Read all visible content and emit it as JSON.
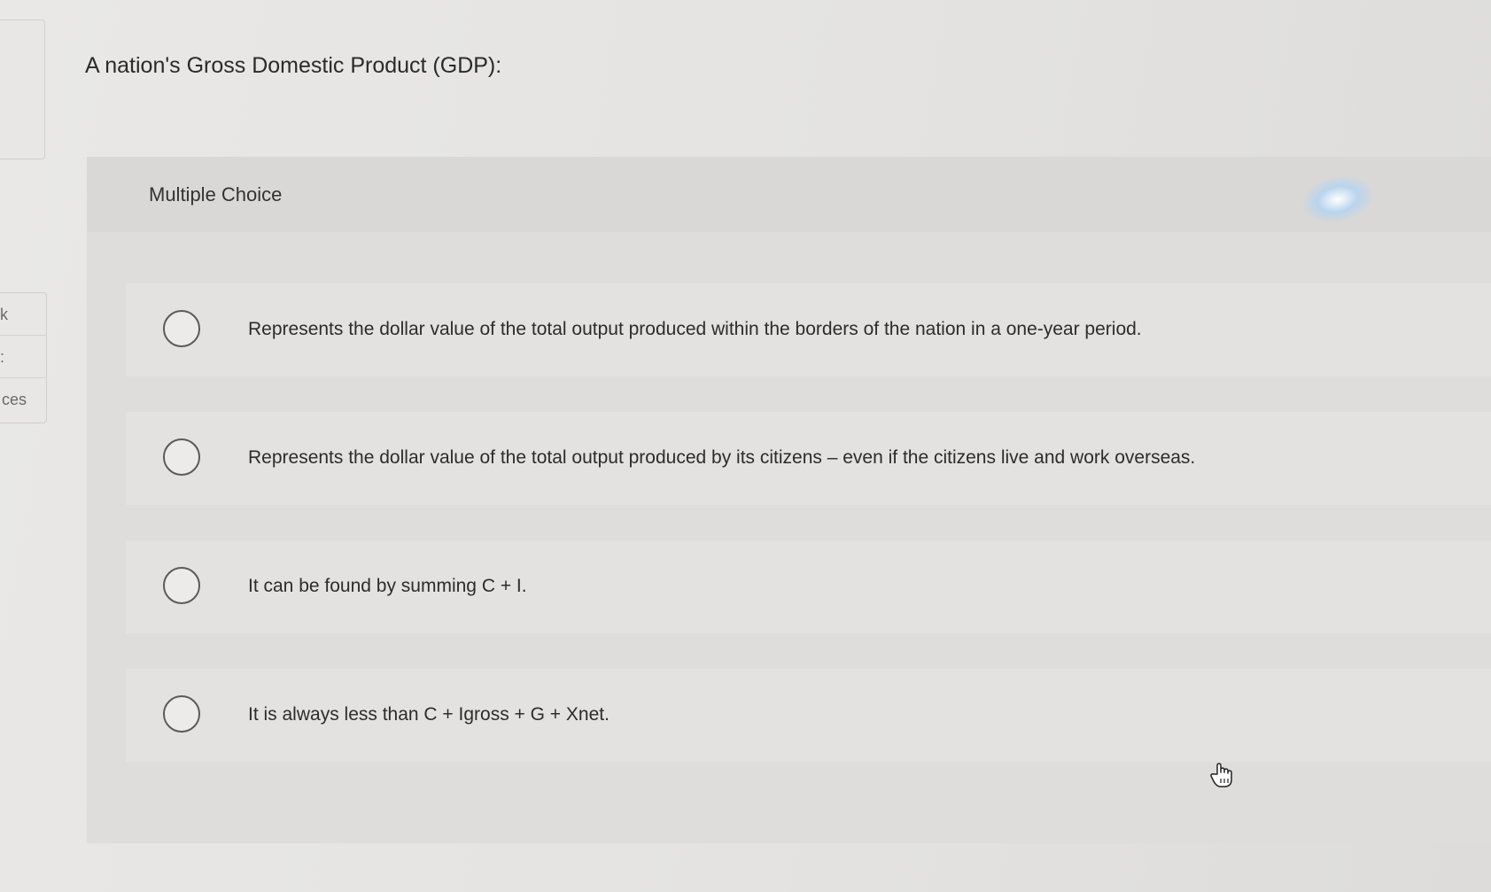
{
  "question": {
    "title": "A nation's Gross Domestic Product (GDP):"
  },
  "side_nav": {
    "items": [
      {
        "label": "k"
      },
      {
        "label": ":"
      },
      {
        "label": "ces"
      }
    ]
  },
  "multiple_choice": {
    "label": "Multiple Choice",
    "options": [
      {
        "text": "Represents the dollar value of the total output produced within the borders of the nation in a one-year period."
      },
      {
        "text": "Represents the dollar value of the total output produced by its citizens – even if the citizens live and work overseas."
      },
      {
        "text": "It can be found by summing C + I."
      },
      {
        "text": "It is always less than C + Igross + G + Xnet."
      }
    ]
  }
}
